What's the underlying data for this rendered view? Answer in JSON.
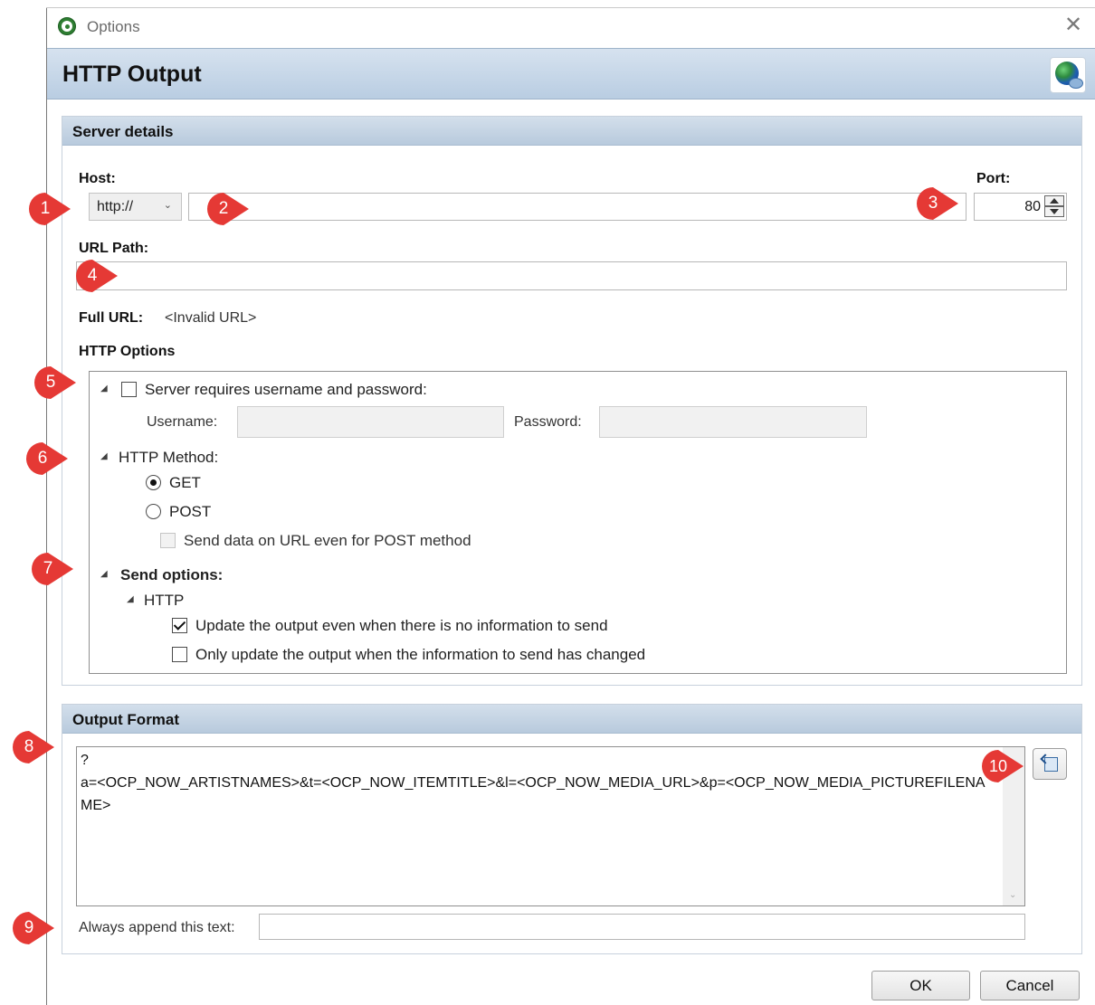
{
  "window": {
    "title": "Options",
    "close_label": "✕"
  },
  "header": {
    "title": "HTTP Output",
    "icon": "globe-icon"
  },
  "server_details": {
    "heading": "Server details",
    "host_label": "Host:",
    "scheme": "http://",
    "host_value": "",
    "port_label": "Port:",
    "port_value": "80",
    "url_path_label": "URL Path:",
    "url_path_value": "",
    "full_url_label": "Full URL:",
    "full_url_value": "<Invalid URL>",
    "http_options_label": "HTTP Options"
  },
  "options_tree": {
    "auth_label": "Server requires username and password:",
    "auth_checked": false,
    "username_label": "Username:",
    "username_value": "",
    "password_label": "Password:",
    "password_value": "",
    "method_label": "HTTP Method:",
    "get_label": "GET",
    "post_label": "POST",
    "selected_method": "GET",
    "send_on_url_label": "Send data on URL even for POST method",
    "send_on_url_checked": false,
    "send_options_label": "Send options:",
    "http_label": "HTTP",
    "update_always_label": "Update the output even when there is no information to send",
    "update_always_checked": true,
    "update_changed_label": "Only update the output when the information to send has changed",
    "update_changed_checked": false
  },
  "output_format": {
    "heading": "Output Format",
    "text": "?\na=<OCP_NOW_ARTISTNAMES>&t=<OCP_NOW_ITEMTITLE>&l=<OCP_NOW_MEDIA_URL>&p=<OCP_NOW_MEDIA_PICTUREFILENAME>",
    "append_label": "Always append this text:",
    "append_value": ""
  },
  "buttons": {
    "ok": "OK",
    "cancel": "Cancel"
  },
  "markers": [
    "1",
    "2",
    "3",
    "4",
    "5",
    "6",
    "7",
    "8",
    "9",
    "10"
  ],
  "colors": {
    "marker": "#e53935",
    "header": "#c7d6e6"
  }
}
